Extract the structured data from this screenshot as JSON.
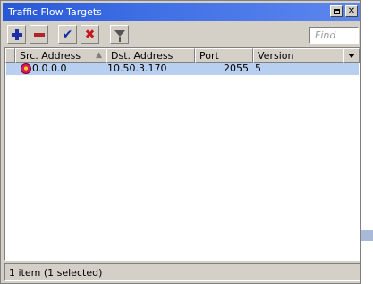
{
  "window": {
    "title": "Traffic Flow Targets",
    "maximize_label": "",
    "close_label": "✕"
  },
  "toolbar": {
    "find_placeholder": "Find"
  },
  "table": {
    "columns": [
      "Src. Address",
      "Dst. Address",
      "Port",
      "Version"
    ],
    "rows": [
      {
        "src": "0.0.0.0",
        "dst": "10.50.3.170",
        "port": "2055",
        "version": "5"
      }
    ]
  },
  "status": "1 item (1 selected)",
  "colors": {
    "title_bar": "#3f6fe4",
    "selected_row": "#b9cff0",
    "add": "#1b2fa8",
    "remove": "#b0242a"
  },
  "icons": [
    "add-icon",
    "remove-icon",
    "enable-icon",
    "disable-icon",
    "filter-icon",
    "target-icon"
  ]
}
